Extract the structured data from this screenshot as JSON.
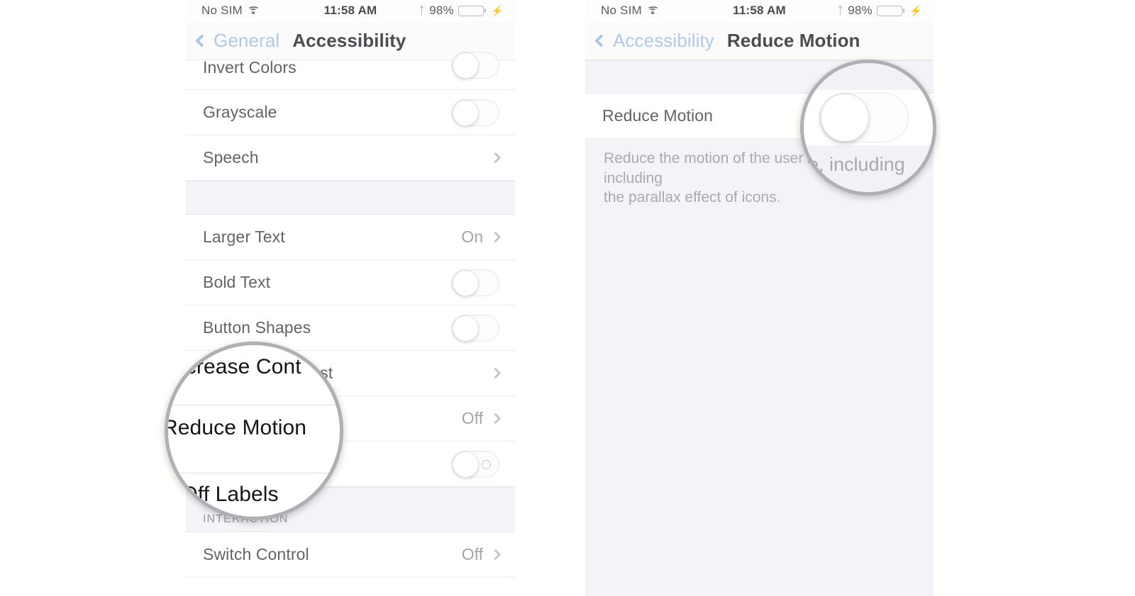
{
  "status_bar": {
    "carrier": "No SIM",
    "wifi_icon": "wifi-icon",
    "time": "11:58 AM",
    "bluetooth_icon": "bluetooth-icon",
    "battery_percent": "98%",
    "charging_icon": "lightning-bolt-icon"
  },
  "left_phone": {
    "nav": {
      "back_icon": "chevron-left-icon",
      "back_label": "General",
      "title": "Accessibility"
    },
    "rows": [
      {
        "label": "Invert Colors",
        "control": "toggle",
        "value": ""
      },
      {
        "label": "Grayscale",
        "control": "toggle",
        "value": ""
      },
      {
        "label": "Speech",
        "control": "chevron",
        "value": ""
      },
      {
        "label": "Larger Text",
        "control": "chevron",
        "value": "On"
      },
      {
        "label": "Bold Text",
        "control": "toggle",
        "value": ""
      },
      {
        "label": "Button Shapes",
        "control": "toggle",
        "value": ""
      },
      {
        "label": "Increase Contrast",
        "control": "chevron",
        "value": ""
      },
      {
        "label": "Reduce Motion",
        "control": "chevron",
        "value": "Off"
      },
      {
        "label": "On/Off Labels",
        "control": "toggle-labeled",
        "value": ""
      }
    ],
    "section_header": "INTERACTION",
    "interaction_rows": [
      {
        "label": "Switch Control",
        "control": "chevron",
        "value": "Off"
      }
    ]
  },
  "right_phone": {
    "nav": {
      "back_icon": "chevron-left-icon",
      "back_label": "Accessibility",
      "title": "Reduce Motion"
    },
    "row": {
      "label": "Reduce Motion",
      "control": "toggle"
    },
    "description_line1": "Reduce the motion of the user interface, including",
    "description_line2": "the parallax effect of icons."
  },
  "left_loupe": {
    "line_top": "ncrease Cont",
    "line_mid": "Reduce Motion",
    "line_bottom": "/Off Labels"
  },
  "right_loupe": {
    "desc_fragment": "e, including",
    "toggle_state": "off"
  },
  "colors": {
    "page_background": "#ffffff",
    "list_background": "#ffffff",
    "grouped_background": "#f4f4f8",
    "nav_tint": "#b3c9e4",
    "title_text": "#4c4c52",
    "row_text": "#636369",
    "secondary_text": "#a3a3ab",
    "separator": "#ececf0",
    "battery_green": "#9fe0a0",
    "loupe_ring": "#b0b0b4"
  }
}
